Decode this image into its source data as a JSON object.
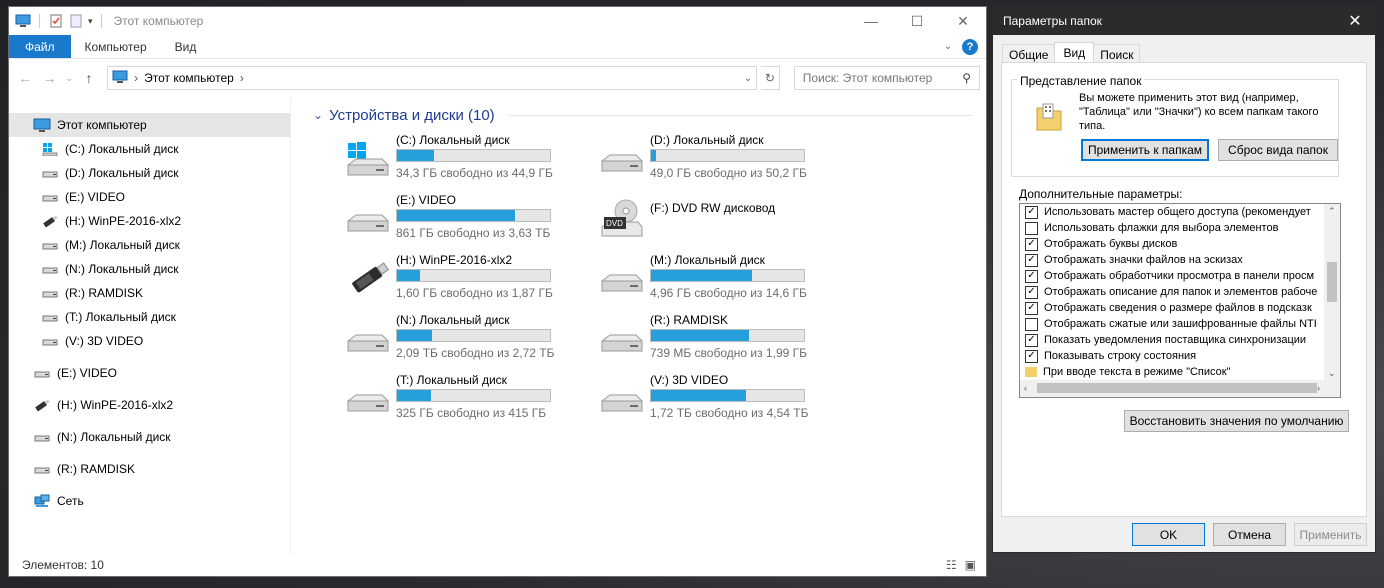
{
  "explorer": {
    "title": "Этот компьютер",
    "ribbon_tabs": [
      "Файл",
      "Компьютер",
      "Вид"
    ],
    "address": {
      "crumb": "Этот компьютер"
    },
    "search": {
      "placeholder": "Поиск: Этот компьютер"
    },
    "nav": {
      "items": [
        {
          "label": "Этот компьютер",
          "icon": "pc-icon",
          "indent": 0,
          "selected": true
        },
        {
          "label": "(C:) Локальный диск",
          "icon": "windows-drive-icon",
          "indent": 1
        },
        {
          "label": "(D:) Локальный диск",
          "icon": "drive-icon",
          "indent": 1
        },
        {
          "label": "(E:) VIDEO",
          "icon": "drive-icon",
          "indent": 1
        },
        {
          "label": "(H:) WinPE-2016-xlx2",
          "icon": "usb-icon",
          "indent": 1
        },
        {
          "label": "(M:) Локальный диск",
          "icon": "drive-icon",
          "indent": 1
        },
        {
          "label": "(N:) Локальный диск",
          "icon": "drive-icon",
          "indent": 1
        },
        {
          "label": "(R:) RAMDISK",
          "icon": "drive-icon",
          "indent": 1
        },
        {
          "label": "(T:) Локальный диск",
          "icon": "drive-icon",
          "indent": 1
        },
        {
          "label": "(V:) 3D VIDEO",
          "icon": "drive-icon",
          "indent": 1
        },
        {
          "label": "(E:) VIDEO",
          "icon": "drive-icon",
          "indent": 0,
          "gap": true
        },
        {
          "label": "(H:) WinPE-2016-xlx2",
          "icon": "usb-icon",
          "indent": 0,
          "gap": true
        },
        {
          "label": "(N:) Локальный диск",
          "icon": "drive-icon",
          "indent": 0,
          "gap": true
        },
        {
          "label": "(R:) RAMDISK",
          "icon": "drive-icon",
          "indent": 0,
          "gap": true
        },
        {
          "label": "Сеть",
          "icon": "network-icon",
          "indent": 0,
          "gap": true
        }
      ]
    },
    "group_title": "Устройства и диски (10)",
    "drives": [
      {
        "name": "(C:) Локальный диск",
        "free": "34,3 ГБ свободно из 44,9 ГБ",
        "used": 0.24,
        "icon": "windows-drive-icon"
      },
      {
        "name": "(D:) Локальный диск",
        "free": "49,0 ГБ свободно из 50,2 ГБ",
        "used": 0.03,
        "icon": "drive-icon"
      },
      {
        "name": "(E:) VIDEO",
        "free": "861 ГБ свободно из 3,63 ТБ",
        "used": 0.77,
        "icon": "drive-icon"
      },
      {
        "name": "(F:) DVD RW дисковод",
        "free": "",
        "used": null,
        "icon": "dvd-icon"
      },
      {
        "name": "(H:) WinPE-2016-xlx2",
        "free": "1,60 ГБ свободно из 1,87 ГБ",
        "used": 0.15,
        "icon": "usb-icon"
      },
      {
        "name": "(M:) Локальный диск",
        "free": "4,96 ГБ свободно из 14,6 ГБ",
        "used": 0.66,
        "icon": "drive-icon"
      },
      {
        "name": "(N:) Локальный диск",
        "free": "2,09 ТБ свободно из 2,72 ТБ",
        "used": 0.23,
        "icon": "drive-icon"
      },
      {
        "name": "(R:) RAMDISK",
        "free": "739 МБ свободно из 1,99 ГБ",
        "used": 0.64,
        "icon": "drive-icon"
      },
      {
        "name": "(T:) Локальный диск",
        "free": "325 ГБ свободно из 415 ГБ",
        "used": 0.22,
        "icon": "drive-icon"
      },
      {
        "name": "(V:) 3D VIDEO",
        "free": "1,72 ТБ свободно из 4,54 ТБ",
        "used": 0.62,
        "icon": "drive-icon"
      }
    ],
    "status": "Элементов: 10"
  },
  "dialog": {
    "title": "Параметры папок",
    "tabs": [
      "Общие",
      "Вид",
      "Поиск"
    ],
    "folder_view_legend": "Представление папок",
    "folder_view_text": "Вы можете применить этот вид (например, \"Таблица\" или \"Значки\") ко всем папкам такого типа.",
    "apply_to_folders": "Применить к папкам",
    "reset_folders": "Сброс вида папок",
    "advanced_label": "Дополнительные параметры:",
    "options": [
      {
        "label": "Использовать мастер общего доступа (рекомендует",
        "checked": true
      },
      {
        "label": "Использовать флажки для выбора элементов",
        "checked": false
      },
      {
        "label": "Отображать буквы дисков",
        "checked": true
      },
      {
        "label": "Отображать значки файлов на эскизах",
        "checked": true
      },
      {
        "label": "Отображать обработчики просмотра в панели просм",
        "checked": true
      },
      {
        "label": "Отображать описание для папок и элементов рабоче",
        "checked": true
      },
      {
        "label": "Отображать сведения о размере файлов в подсказк",
        "checked": true
      },
      {
        "label": "Отображать сжатые или зашифрованные файлы NTI",
        "checked": false
      },
      {
        "label": "Показать уведомления поставщика синхронизации",
        "checked": true
      },
      {
        "label": "Показывать строку состояния",
        "checked": true
      },
      {
        "label": "При вводе текста в режиме \"Список\"",
        "folder": true
      }
    ],
    "restore_defaults": "Восстановить значения по умолчанию",
    "ok": "OK",
    "cancel": "Отмена",
    "apply": "Применить"
  }
}
